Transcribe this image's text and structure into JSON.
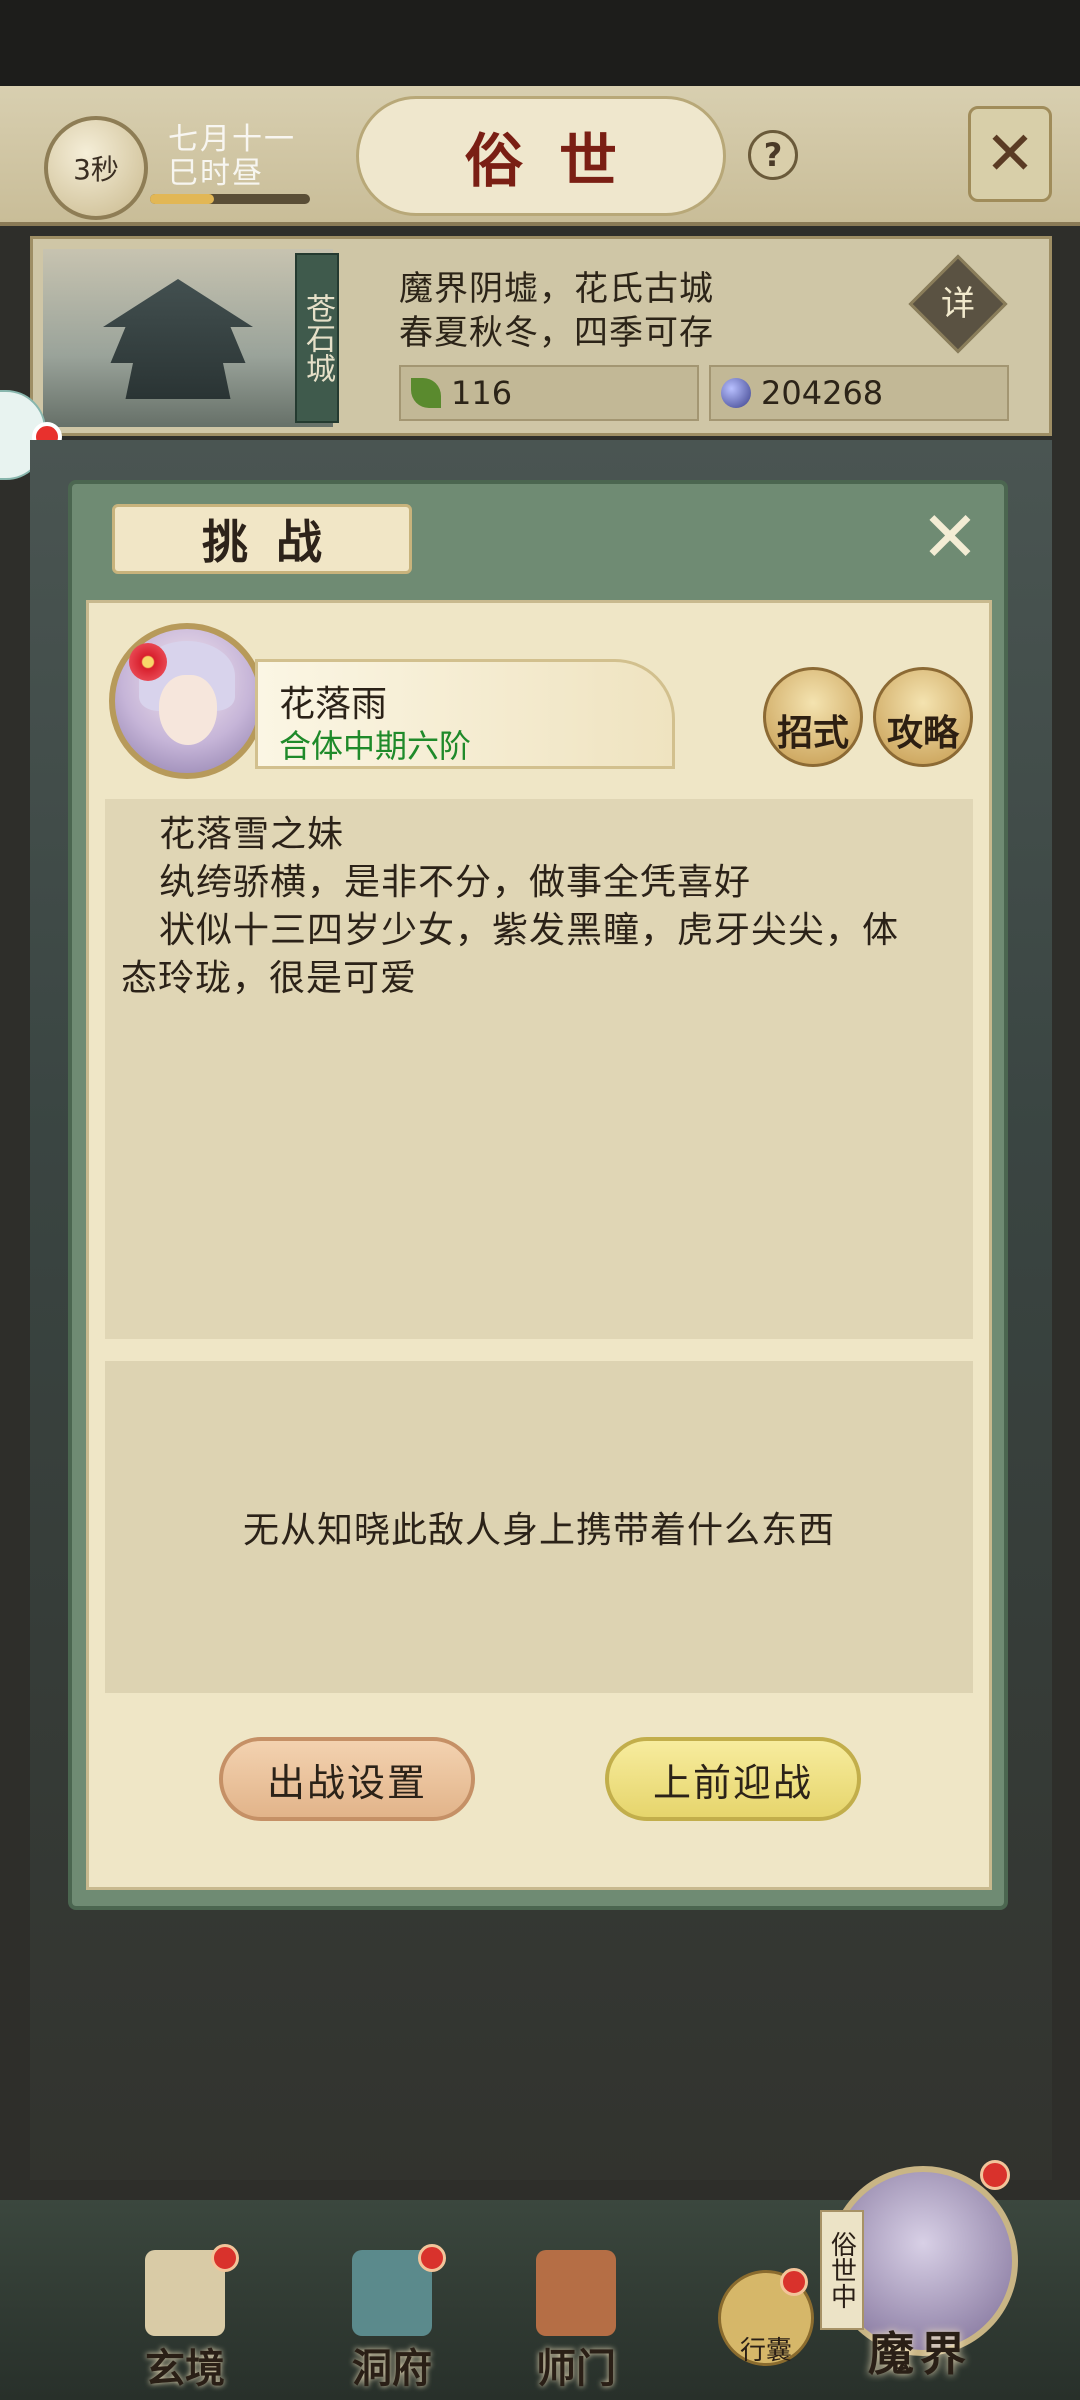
{
  "header": {
    "timer": "3秒",
    "date_line1": "七月十一",
    "date_line2": "巳时昼",
    "date_progress": 0.4,
    "title": "俗世",
    "help_glyph": "?",
    "close_glyph": "✕"
  },
  "location": {
    "city_name": "苍石城",
    "desc_line1": "魔界阴墟，花氏古城",
    "desc_line2": "春夏秋冬，四季可存",
    "detail_label": "详",
    "resource_spirit": "116",
    "resource_stone": "204268"
  },
  "dialog": {
    "title": "挑战",
    "close_glyph": "✕",
    "character": {
      "name": "花落雨",
      "rank": "合体中期六阶"
    },
    "skill_label": "招式",
    "guide_label": "攻略",
    "description": [
      "花落雪之妹",
      "纨绔骄横，是非不分，做事全凭喜好",
      "状似十三四岁少女，紫发黑瞳，虎牙尖尖，体",
      "态玲珑，很是可爱"
    ],
    "loot_text": "无从知晓此敌人身上携带着什么东西",
    "setup_button": "出战设置",
    "fight_button": "上前迎战"
  },
  "bottom_nav": {
    "items": [
      {
        "label": "玄境"
      },
      {
        "label": "洞府"
      },
      {
        "label": "师门"
      }
    ],
    "bag_label": "行囊",
    "realm_tag": "俗世中",
    "realm_label": "魔界"
  },
  "colors": {
    "title_red": "#7a1f14",
    "rank_green": "#1f8a2a",
    "dialog_frame": "#6f8b73",
    "notification_red": "#d9322c"
  }
}
